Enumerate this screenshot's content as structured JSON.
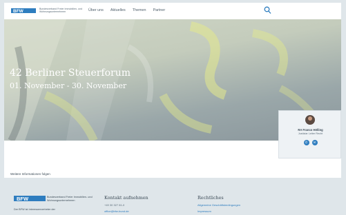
{
  "header": {
    "logo_tagline": "Bundesverband Freier Immobilien- und Wohnungsunternehmen",
    "nav": [
      "Über uns",
      "Aktuelles",
      "Themen",
      "Partner"
    ]
  },
  "hero": {
    "title": "42 Berliner Steuerforum",
    "subtitle": "01. November - 30. November"
  },
  "contact_card": {
    "name": "RA Franco Hölling",
    "role": "Justiziar Leiter Recht",
    "icons": [
      "phone-icon",
      "mail-icon"
    ]
  },
  "content": {
    "info": "Weitere Informationen folgen"
  },
  "footer": {
    "logo_tagline": "Bundesverband Freier Immobilien- und Wohnungsunternehmen",
    "description": "Der BFW ist Interessenvertreter der",
    "contact": {
      "title": "Kontakt aufnehmen",
      "phone": "+49 30 327 81-0",
      "email": "office@bfw-bund.de"
    },
    "legal": {
      "title": "Rechtliches",
      "links": [
        "Allgemeine Geschäftsbedingungen",
        "Impressum"
      ]
    }
  },
  "colors": {
    "brand_blue": "#2e7dbf",
    "text_dark": "#3b4a56",
    "footer_bg": "#dfe6ea"
  }
}
